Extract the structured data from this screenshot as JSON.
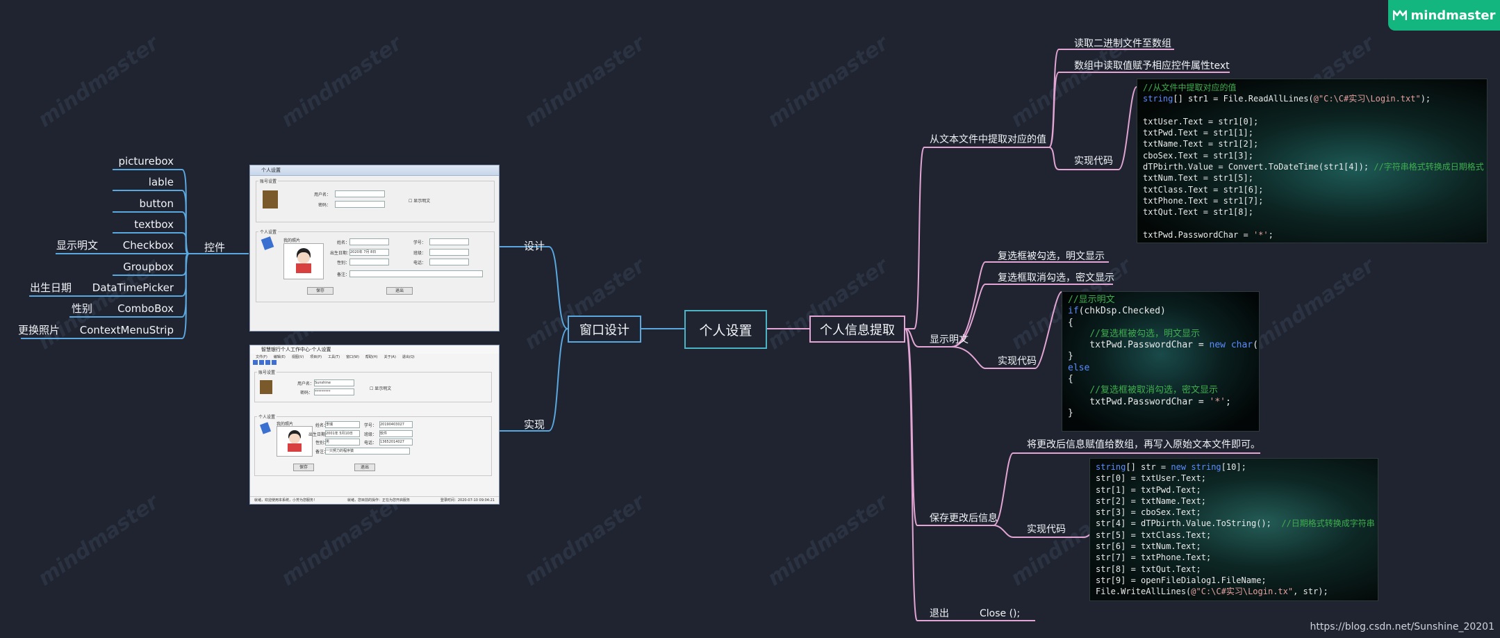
{
  "logo": {
    "text": "mindmaster"
  },
  "watermark": "mindmaster",
  "credit": "https://blog.csdn.net/Sunshine_20201",
  "central": {
    "label": "个人设置"
  },
  "left_branch": {
    "label": "窗口设计",
    "design": {
      "label": "设计"
    },
    "implement": {
      "label": "实现"
    },
    "controls": {
      "label": "控件",
      "items": [
        {
          "label": "picturebox",
          "note": ""
        },
        {
          "label": "lable",
          "note": ""
        },
        {
          "label": "button",
          "note": ""
        },
        {
          "label": "textbox",
          "note": ""
        },
        {
          "label": "Checkbox",
          "note": "显示明文"
        },
        {
          "label": "Groupbox",
          "note": ""
        },
        {
          "label": "DataTimePicker",
          "note": "出生日期"
        },
        {
          "label": "ComboBox",
          "note": "性别"
        },
        {
          "label": "ContextMenuStrip",
          "note": "更换照片"
        }
      ]
    }
  },
  "right_branch": {
    "label": "个人信息提取",
    "extract": {
      "label": "从文本文件中提取对应的值",
      "items": [
        "读取二进制文件至数组",
        "数组中读取值赋予相应控件属性text"
      ],
      "code_label": "实现代码",
      "code": [
        "//从文件中提取对应的值",
        "string[] str1 = File.ReadAllLines(@\"C:\\C#实习\\Login.txt\");",
        "",
        "txtUser.Text = str1[0];",
        "txtPwd.Text = str1[1];",
        "txtName.Text = str1[2];",
        "cboSex.Text = str1[3];",
        "dTPbirth.Value = Convert.ToDateTime(str1[4]); //字符串格式转换成日期格式",
        "txtNum.Text = str1[5];",
        "txtClass.Text = str1[6];",
        "txtPhone.Text = str1[7];",
        "txtQut.Text = str1[8];",
        "",
        "txtPwd.PasswordChar = '*';"
      ]
    },
    "show": {
      "label": "显示明文",
      "items": [
        "复选框被勾选，明文显示",
        "复选框取消勾选，密文显示"
      ],
      "code_label": "实现代码",
      "code": [
        "//显示明文",
        "if(chkDsp.Checked)",
        "{",
        "    //复选框被勾选，明文显示",
        "    txtPwd.PasswordChar = new char();",
        "}",
        "else",
        "{",
        "    //复选框被取消勾选，密文显示",
        "    txtPwd.PasswordChar = '*';",
        "}"
      ]
    },
    "save": {
      "label": "保存更改后信息",
      "note": "将更改后信息赋值给数组，再写入原始文本文件即可。",
      "code_label": "实现代码",
      "code": [
        "string[] str = new string[10];",
        "str[0] = txtUser.Text;",
        "str[1] = txtPwd.Text;",
        "str[2] = txtName.Text;",
        "str[3] = cboSex.Text;",
        "str[4] = dTPbirth.Value.ToString();  //日期格式转换成字符串",
        "str[5] = txtClass.Text;",
        "str[6] = txtNum.Text;",
        "str[7] = txtPhone.Text;",
        "str[8] = txtQut.Text;",
        "str[9] = openFileDialog1.FileName;",
        "File.WriteAllLines(@\"C:\\C#实习\\Login.tx\", str);"
      ]
    },
    "exit": {
      "label": "退出",
      "code": "Close ();"
    }
  },
  "screenshot_design": {
    "title": "个人设置",
    "group1": "账号设置",
    "user_label": "用户名：",
    "pwd_label": "密码：",
    "show_pwd": "显示明文",
    "group2": "个人设置",
    "photo_label": "我的照片",
    "name_label": "姓名：",
    "birth_label": "出生日期：",
    "birth_value": "2020年 7月 8日",
    "sex_label": "性别：",
    "note_label": "备注：",
    "num_label": "学号：",
    "class_label": "班级：",
    "phone_label": "电话：",
    "save_btn": "保存",
    "exit_btn": "退出"
  },
  "screenshot_impl": {
    "title": "智慧银行个人工作中心-个人设置",
    "menu": [
      "文件(F)",
      "编辑(E)",
      "视图(V)",
      "项目(P)",
      "工具(T)",
      "窗口(W)",
      "帮助(H)",
      "关于(A)",
      "退出(Q)"
    ],
    "group1": "账号设置",
    "user_label": "用户名：",
    "user_value": "Sunshine",
    "pwd_label": "密码：",
    "pwd_value": "*********",
    "show_pwd": "显示明文",
    "group2": "个人设置",
    "photo_label": "我的照片",
    "name_label": "姓名：",
    "name_value": "李瑞",
    "birth_label": "出生日期：",
    "birth_value": "2001年 5月10日",
    "sex_label": "性别：",
    "sex_value": "男",
    "note_label": "备注：",
    "note_value": "一只努力的程序猿",
    "num_label": "学号：",
    "num_value": "20190403027",
    "class_label": "班级：",
    "class_value": "软件",
    "phone_label": "电话：",
    "phone_value": "13652014027",
    "save_btn": "保存",
    "exit_btn": "退出",
    "status": [
      "就绪，欢迎使用本系统，小芳为您服务！",
      "就绪，您目前的操作：正在为您开启服务",
      "登录时间：2020-07-10 09:04:21"
    ]
  },
  "colors": {
    "background": "#1f2430",
    "left_line": "#5aa8e0",
    "right_line": "#e3a5d4",
    "center_border": "#4cb5c5",
    "logo": "#14b67f"
  }
}
